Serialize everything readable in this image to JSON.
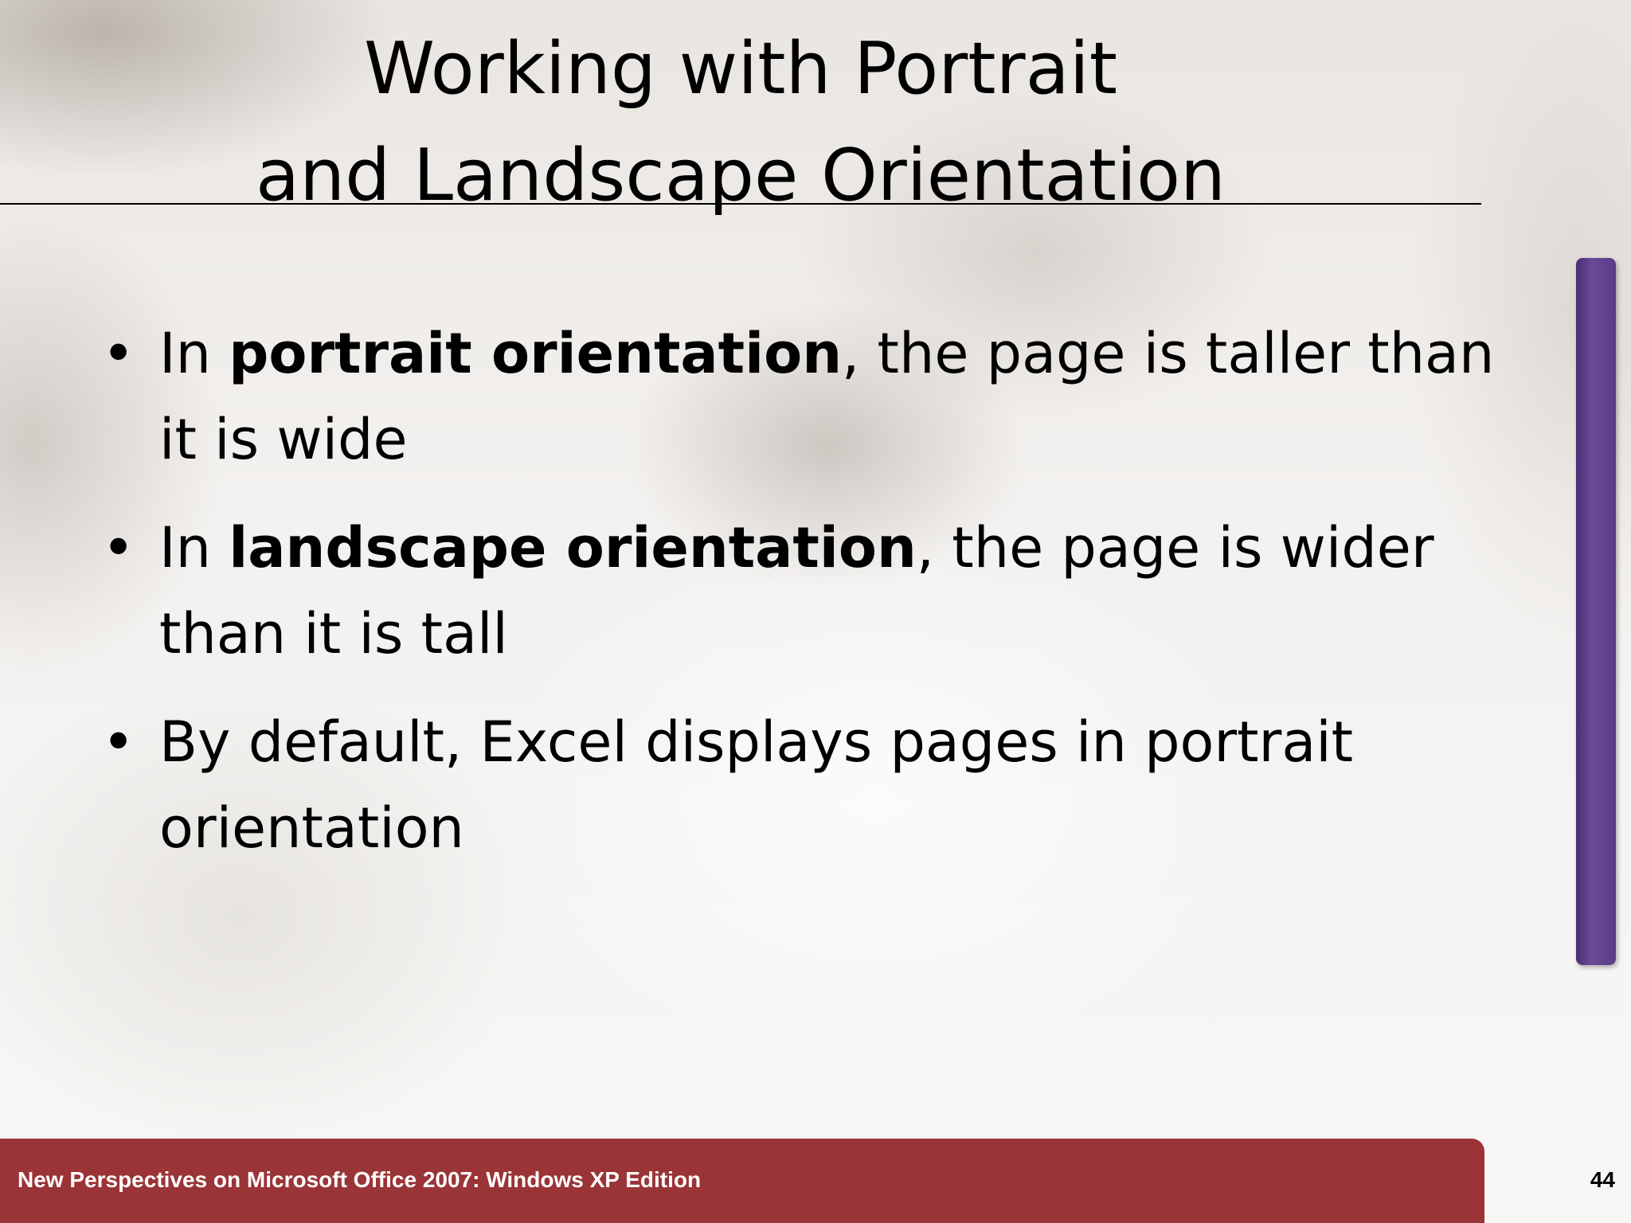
{
  "slide": {
    "title_line1": "Working with Portrait",
    "title_line2": "and Landscape Orientation",
    "bullet_symbol": "•",
    "bullets": [
      {
        "prefix": "In ",
        "bold": "portrait orientation",
        "suffix": ", the page is taller than it is wide"
      },
      {
        "prefix": "In ",
        "bold": "landscape orientation",
        "suffix": ", the page is wider than it is tall"
      },
      {
        "text": "By default, Excel displays pages in portrait orientation"
      }
    ],
    "footer": "New Perspectives on Microsoft Office 2007: Windows XP Edition",
    "page_number": "44"
  },
  "colors": {
    "footer_bar": "#9a3437",
    "accent_bar": "#5a3b86"
  }
}
